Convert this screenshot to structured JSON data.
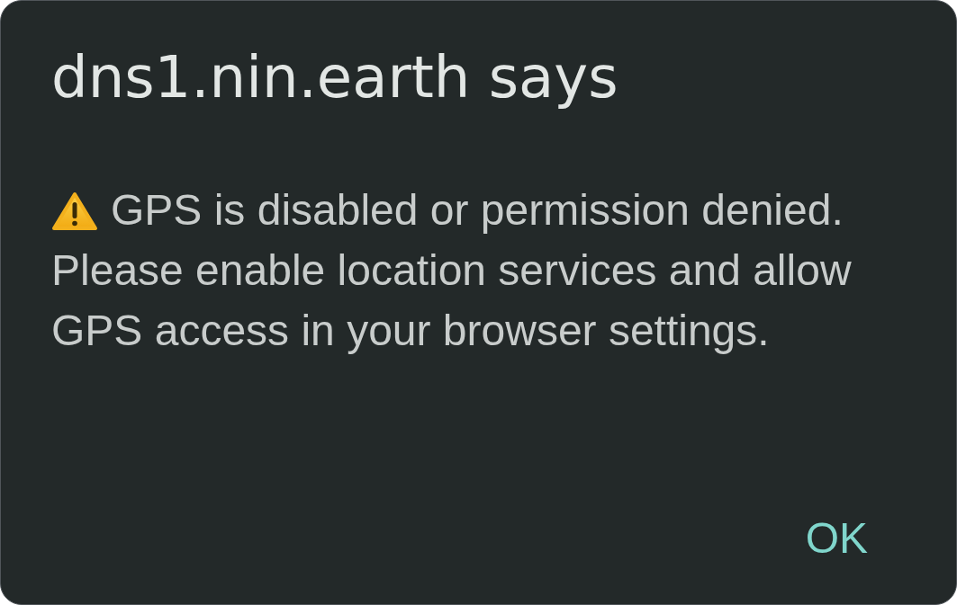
{
  "dialog": {
    "title": "dns1.nin.earth says",
    "message": {
      "warning": "GPS is disabled or permission denied.",
      "details": "Please enable location services and allow GPS access in your browser settings."
    },
    "buttons": [
      "OK"
    ]
  }
}
